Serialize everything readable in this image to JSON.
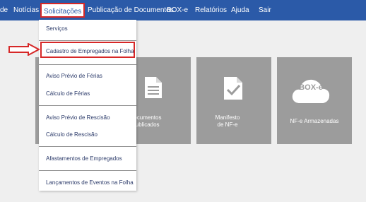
{
  "nav": {
    "items": [
      "de",
      "Notícias",
      "Solicitações",
      "Publicação de Documentos",
      "BOX-e",
      "Relatórios",
      "Ajuda",
      "Sair"
    ],
    "active_index": 2
  },
  "menu": {
    "items": [
      "Serviços",
      "Cadastro de Empregados na Folha",
      "Aviso Prévio de Férias",
      "Cálculo de Férias",
      "Aviso Prévio de Rescisão",
      "Cálculo de Rescisão",
      "Afastamentos de Empregados",
      "Lançamentos de Eventos na Folha"
    ]
  },
  "tiles": [
    {
      "label": "Documentos\nPublicados",
      "icon": "document-icon"
    },
    {
      "label": "Manifesto\nde NF-e",
      "icon": "document-check-icon"
    },
    {
      "label": "NF-e Armazenadas",
      "icon": "cloud-icon",
      "badge": "BOX-e"
    }
  ],
  "colors": {
    "topbar": "#2b5aa8",
    "highlight": "#d62828",
    "tile": "#9c9c9c",
    "menu_text": "#2c3b6a"
  }
}
